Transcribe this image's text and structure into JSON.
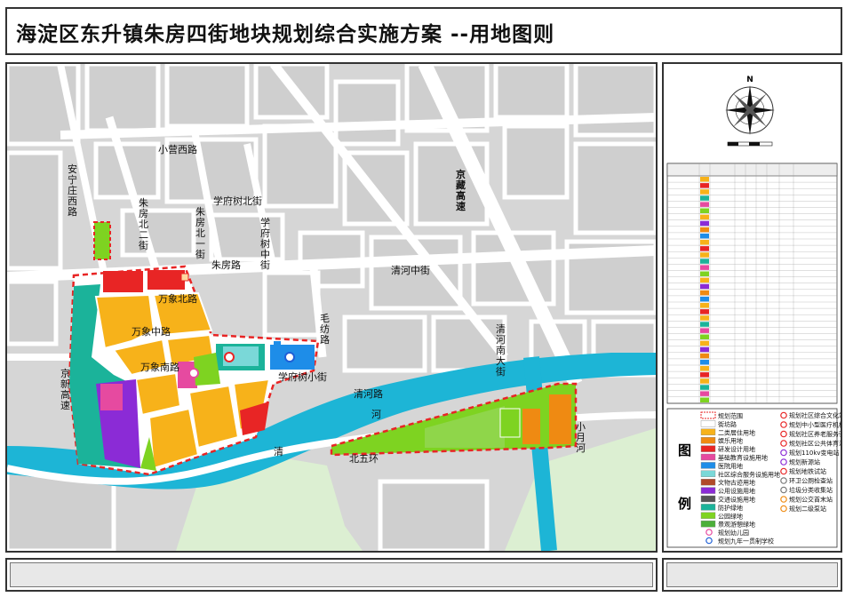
{
  "title": "海淀区东升镇朱房四街地块规划综合实施方案 --用地图则",
  "colors": {
    "residential": "#f7b21a",
    "commercial": "#e82525",
    "research": "#ef8a12",
    "education": "#e64aa0",
    "hospital": "#1e8de8",
    "community": "#7ad8d8",
    "public_util": "#8b2bd6",
    "protective": "#1bb39a",
    "park": "#7ed321",
    "road": "#ffffff",
    "water": "#1db5d6",
    "block": "#d6d6d6",
    "green_bg": "#e2f0d9"
  },
  "roads": {
    "xiaoying_west": "小营西路",
    "anning_west": "安宁庄西路",
    "zhufang_bei2": "朱房北二街",
    "zhufang_bei1": "朱房北一街",
    "xuefu_shu_bei": "学府树北街",
    "xuefu_shu_zhong": "学府树中街",
    "jingzang": "京藏高速",
    "zhufang_lu": "朱房路",
    "qinghe_zhong": "清河中街",
    "maofang": "毛纺路",
    "wanxiang_bei": "万象北路",
    "wanxiang_zhong": "万象中路",
    "wanxiang_nan": "万象南路",
    "xuefu_shu_nan": "学府树小街",
    "jingxin": "京新高速",
    "qinghe_nan": "清河南大街",
    "qinghe_lu": "清河路",
    "he": "河",
    "qing": "清",
    "bei5": "北五环",
    "xiaoyue": "小月河"
  },
  "compass": {
    "north": "N"
  },
  "legend": {
    "heading": "图",
    "heading2": "例",
    "items": [
      {
        "label": "规划范围",
        "color": "#ffffff",
        "style": "dash"
      },
      {
        "label": "街坊路",
        "color": "#ffffff",
        "style": "box"
      },
      {
        "label": "二类居住用地",
        "color": "#f7b21a",
        "style": "box"
      },
      {
        "label": "娱乐用地",
        "color": "#ef8a12",
        "style": "box"
      },
      {
        "label": "研发设计用地",
        "color": "#e82525",
        "style": "box"
      },
      {
        "label": "基础教育设施用地",
        "color": "#e64aa0",
        "style": "box"
      },
      {
        "label": "医院用地",
        "color": "#1e8de8",
        "style": "box"
      },
      {
        "label": "社区综合服务设施用地",
        "color": "#7ad8d8",
        "style": "box"
      },
      {
        "label": "文物古迹用地",
        "color": "#b04a2a",
        "style": "box"
      },
      {
        "label": "公用设施用地",
        "color": "#8b2bd6",
        "style": "box"
      },
      {
        "label": "交通设施用地",
        "color": "#555555",
        "style": "box"
      },
      {
        "label": "防护绿地",
        "color": "#1bb39a",
        "style": "box"
      },
      {
        "label": "公园绿地",
        "color": "#7ed321",
        "style": "box"
      },
      {
        "label": "景观游憩绿地",
        "color": "#4caf3a",
        "style": "box"
      },
      {
        "label": "规划幼儿园",
        "color": "#e64aa0",
        "style": "circle"
      },
      {
        "label": "规划九年一贯制学校",
        "color": "#1e5fd6",
        "style": "circle"
      }
    ],
    "items_right": [
      {
        "label": "规划社区综合文化站",
        "color": "#e82525"
      },
      {
        "label": "规划中小型医疗机构",
        "color": "#e82525"
      },
      {
        "label": "规划社区养老服务驿站",
        "color": "#e82525"
      },
      {
        "label": "规划社区公共体育活动",
        "color": "#e82525"
      },
      {
        "label": "规划110kv变电站",
        "color": "#8b2bd6"
      },
      {
        "label": "规划新源站",
        "color": "#8b2bd6"
      },
      {
        "label": "规划地铁试站",
        "color": "#e82525"
      },
      {
        "label": "环卫公厕检查站",
        "color": "#777777"
      },
      {
        "label": "垃圾分类收集站",
        "color": "#777777"
      },
      {
        "label": "规划公交首末站",
        "color": "#ef8a12"
      },
      {
        "label": "规划二级泵站",
        "color": "#ef8a12"
      }
    ]
  }
}
